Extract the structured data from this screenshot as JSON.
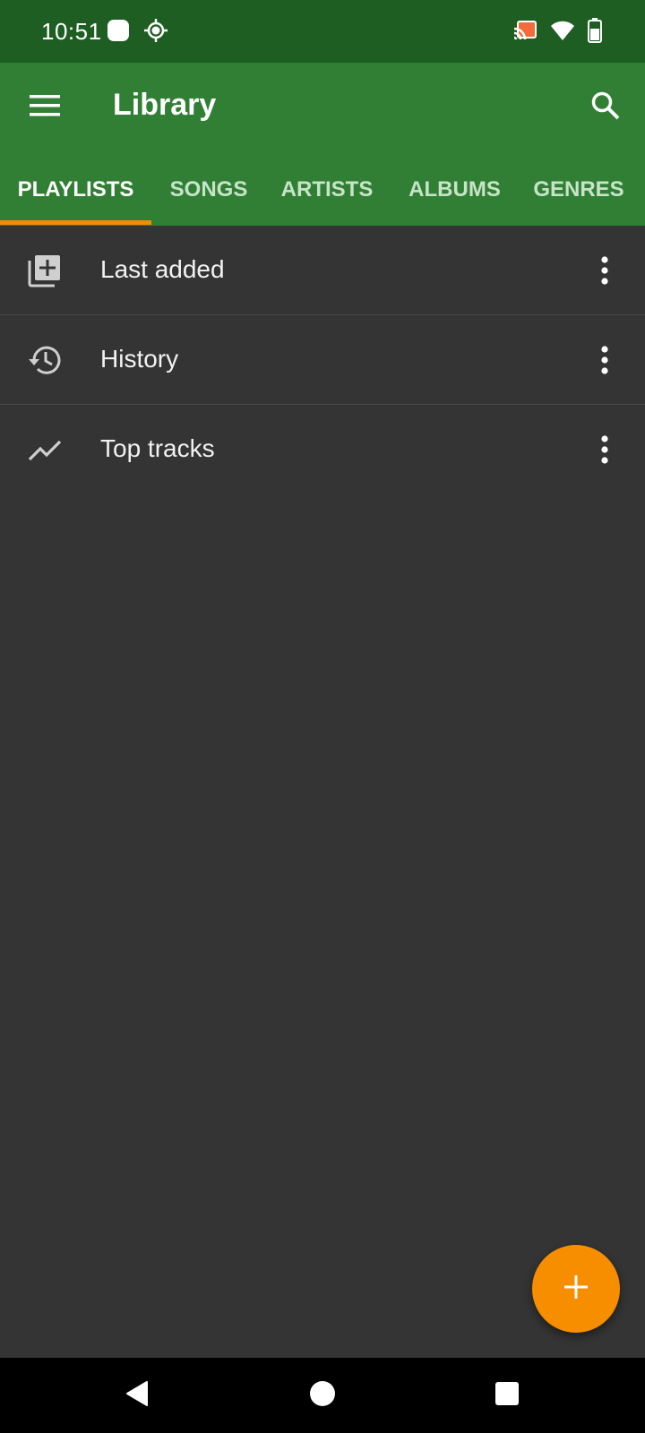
{
  "status_bar": {
    "time": "10:51",
    "icons": [
      "notification-icon",
      "location-icon",
      "cast-icon",
      "wifi-icon",
      "battery-icon"
    ]
  },
  "app_bar": {
    "title": "Library",
    "menu_icon": "menu-icon",
    "search_icon": "search-icon"
  },
  "tabs": [
    {
      "label": "PLAYLISTS",
      "active": true
    },
    {
      "label": "SONGS",
      "active": false
    },
    {
      "label": "ARTISTS",
      "active": false
    },
    {
      "label": "ALBUMS",
      "active": false
    },
    {
      "label": "GENRES",
      "active": false
    }
  ],
  "playlists": [
    {
      "label": "Last added",
      "icon": "library-add-icon"
    },
    {
      "label": "History",
      "icon": "history-icon"
    },
    {
      "label": "Top tracks",
      "icon": "trending-icon"
    }
  ],
  "fab": {
    "icon": "plus-icon"
  },
  "colors": {
    "status_bar": "#1e5e22",
    "app_bar": "#317f34",
    "background": "#343434",
    "accent": "#f68e00",
    "active_tab_indicator": "#f28c00"
  },
  "nav_bar": {
    "icons": [
      "back-icon",
      "home-icon",
      "recents-icon"
    ]
  }
}
